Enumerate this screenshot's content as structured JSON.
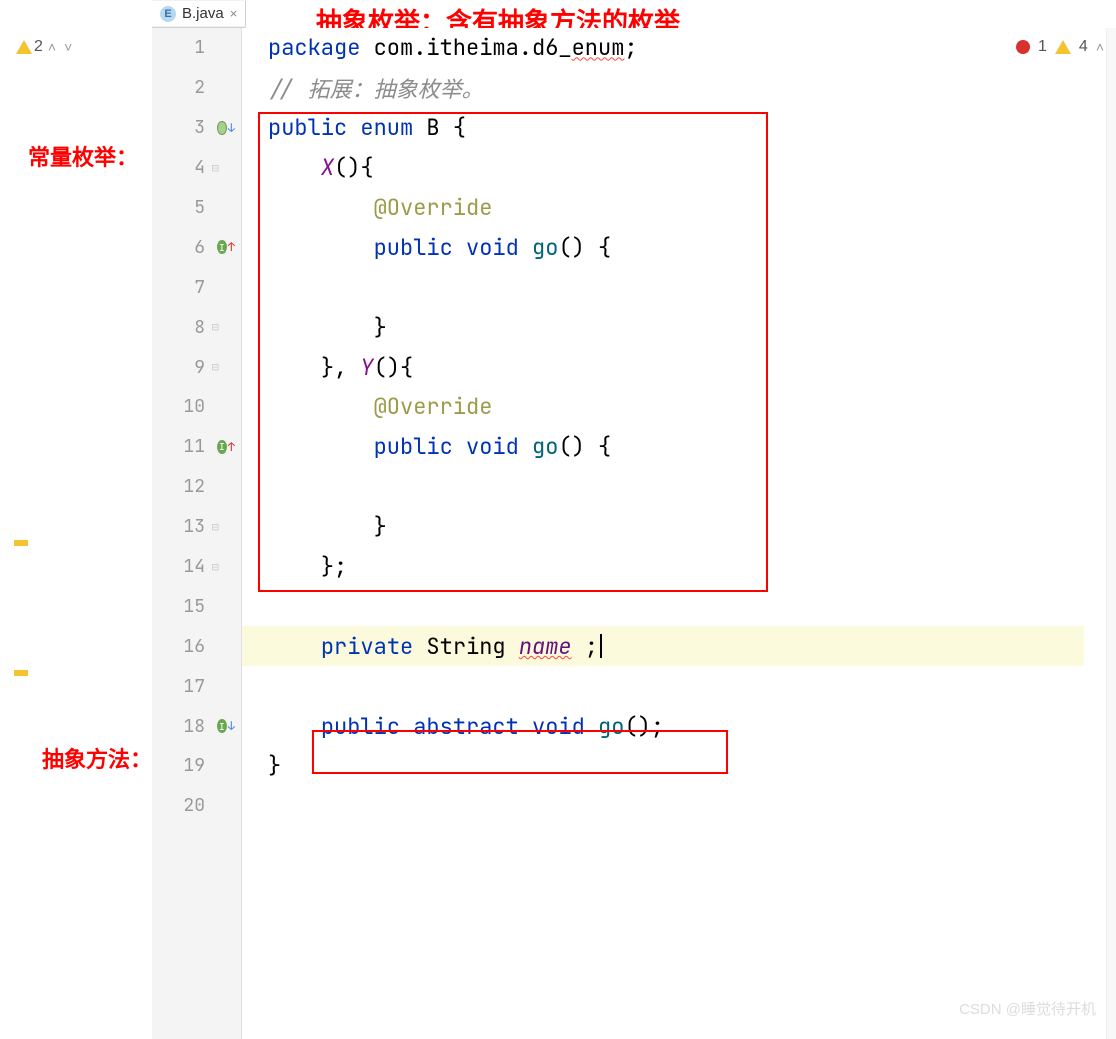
{
  "tab": {
    "icon_letter": "E",
    "filename": "B.java",
    "close": "×"
  },
  "left_status": {
    "count": "2"
  },
  "right_status": {
    "err_count": "1",
    "warn_count": "4"
  },
  "labels": {
    "title": "抽象枚举：含有抽象方法的枚举",
    "constant": "常量枚举：",
    "abstract_method": "抽象方法："
  },
  "lines": [
    {
      "n": "1"
    },
    {
      "n": "2"
    },
    {
      "n": "3"
    },
    {
      "n": "4"
    },
    {
      "n": "5"
    },
    {
      "n": "6"
    },
    {
      "n": "7"
    },
    {
      "n": "8"
    },
    {
      "n": "9"
    },
    {
      "n": "10"
    },
    {
      "n": "11"
    },
    {
      "n": "12"
    },
    {
      "n": "13"
    },
    {
      "n": "14"
    },
    {
      "n": "15"
    },
    {
      "n": "16"
    },
    {
      "n": "17"
    },
    {
      "n": "18"
    },
    {
      "n": "19"
    },
    {
      "n": "20"
    }
  ],
  "code": {
    "l1_kw": "package",
    "l1_pkg": " com.itheima.d6_enum",
    "l1_pkg_wavy": "enum",
    "l1_end": ";",
    "l2": "// 拓展：抽象枚举。",
    "l3_kw1": "public",
    "l3_kw2": "enum",
    "l3_name": "B",
    "l3_brace": " {",
    "l4_name": "X",
    "l4_rest": "(){",
    "l5_ann": "@Override",
    "l6_kw1": "public",
    "l6_kw2": "void",
    "l6_m": "go",
    "l6_rest": "() {",
    "l8": "}",
    "l9_a": "}, ",
    "l9_name": "Y",
    "l9_b": "(){",
    "l10_ann": "@Override",
    "l11_kw1": "public",
    "l11_kw2": "void",
    "l11_m": "go",
    "l11_rest": "() {",
    "l13": "}",
    "l14": "};",
    "l16_kw1": "private",
    "l16_type": "String",
    "l16_var": "name",
    "l16_end": ";",
    "l18_kw1": "public",
    "l18_kw2": "abstract",
    "l18_kw3": "void",
    "l18_m": "go",
    "l18_rest": "();",
    "l19": "}"
  },
  "watermark": "CSDN @睡觉待开机"
}
